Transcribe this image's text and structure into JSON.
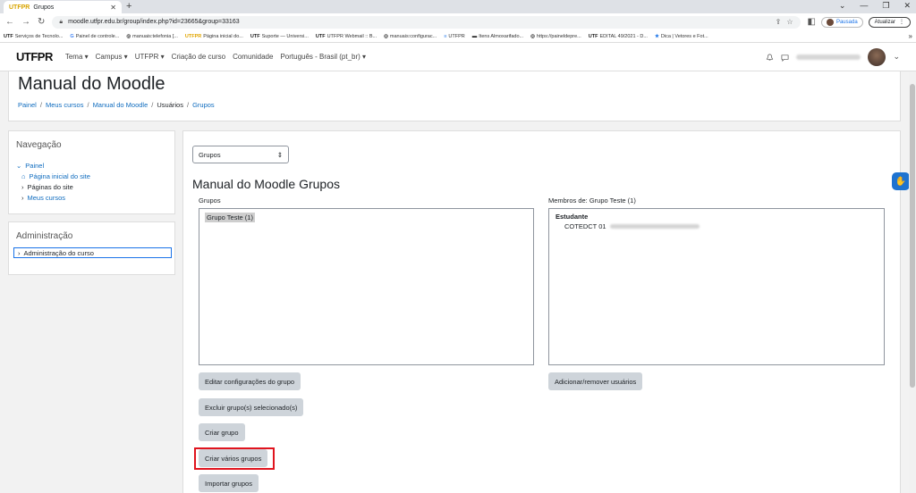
{
  "browser": {
    "tab_title": "Grupos",
    "tab_favicon": "UTFPR",
    "url": "moodle.utfpr.edu.br/group/index.php?id=23665&group=33163",
    "profile_label": "Pausada",
    "update_label": "Atualizar",
    "bookmarks": [
      {
        "icon": "UTF",
        "label": "Serviços de Tecnolo..."
      },
      {
        "icon": "G",
        "label": "Painel de controle..."
      },
      {
        "icon": "◎",
        "label": "manuais:telefonia [..."
      },
      {
        "icon": "UTFPR",
        "label": "Página inicial do..."
      },
      {
        "icon": "UTF",
        "label": "Suporte — Universi..."
      },
      {
        "icon": "UTF",
        "label": "UTFPR Webmail :: B..."
      },
      {
        "icon": "◎",
        "label": "manuais:configurac..."
      },
      {
        "icon": "≡",
        "label": "UTFPR"
      },
      {
        "icon": "▬",
        "label": "Itens Almoxarifado..."
      },
      {
        "icon": "◎",
        "label": "https://paineldepre..."
      },
      {
        "icon": "UTF",
        "label": "EDITAL 49/2021 - D..."
      },
      {
        "icon": "★",
        "label": "Dica | Vetores e Fot..."
      }
    ]
  },
  "navbar": {
    "logo": "UTFPR",
    "menu": [
      "Tema ▾",
      "Campus ▾",
      "UTFPR ▾",
      "Criação de curso",
      "Comunidade",
      "Português - Brasil (pt_br) ▾"
    ]
  },
  "header": {
    "title": "Manual do Moodle",
    "breadcrumbs": [
      "Painel",
      "Meus cursos",
      "Manual do Moodle",
      "Usuários",
      "Grupos"
    ]
  },
  "navigation_block": {
    "title": "Navegação",
    "root": "Painel",
    "items": [
      "Página inicial do site",
      "Páginas do site",
      "Meus cursos"
    ]
  },
  "admin_block": {
    "title": "Administração",
    "item": "Administração do curso"
  },
  "main": {
    "select_value": "Grupos",
    "heading": "Manual do Moodle Grupos",
    "groups_label": "Grupos",
    "groups": [
      "Grupo Teste (1)"
    ],
    "members_label": "Membros de: Grupo Teste (1)",
    "members_role": "Estudante",
    "members": [
      "COTEDCT 01"
    ],
    "buttons": {
      "edit": "Editar configurações do grupo",
      "delete": "Excluir grupo(s) selecionado(s)",
      "create": "Criar grupo",
      "create_many": "Criar vários grupos",
      "import": "Importar grupos",
      "add_remove": "Adicionar/remover usuários"
    }
  },
  "colors": {
    "link": "#0f6cbf",
    "highlight": "#e0141e",
    "button_bg": "#ced4da"
  }
}
